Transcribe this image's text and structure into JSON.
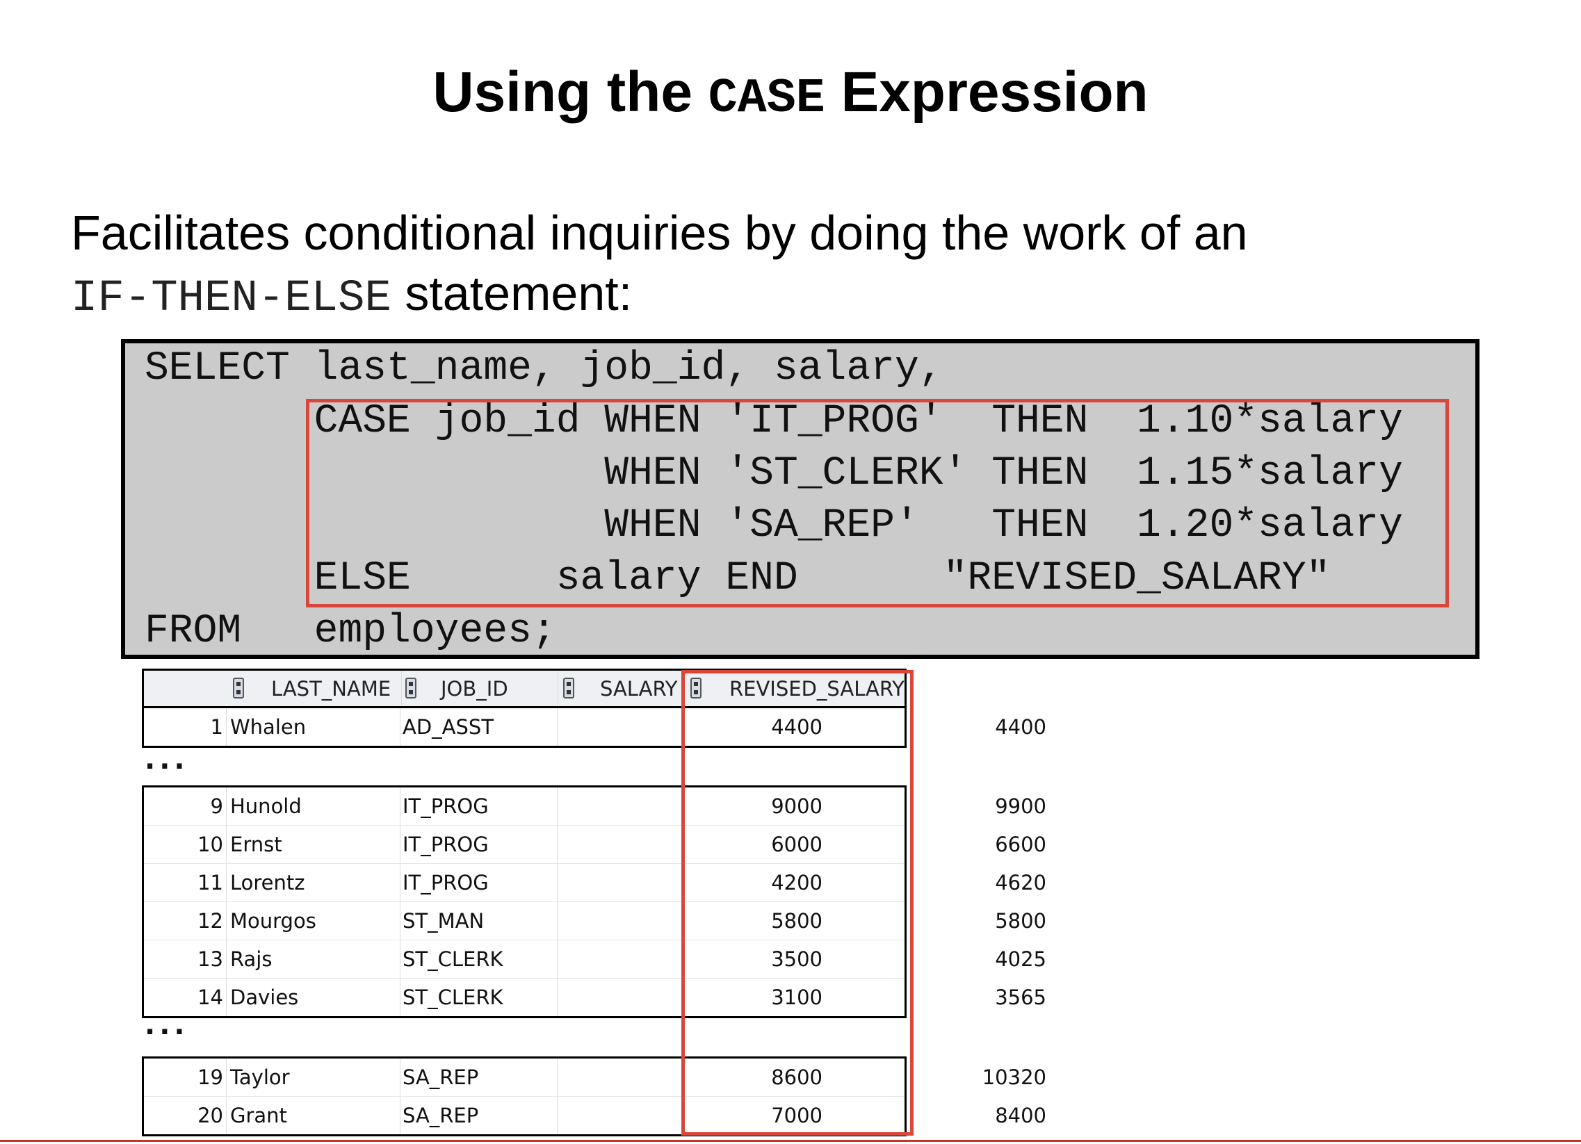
{
  "slide": {
    "title_prefix": "Using the",
    "title_keyword": "CASE",
    "title_suffix": "Expression",
    "description_line1": "Facilitates conditional inquiries by doing the work of an",
    "description_keyword": "IF-THEN-ELSE",
    "description_suffix": "statement:"
  },
  "code": {
    "lines": [
      "SELECT last_name, job_id, salary,",
      "       CASE job_id WHEN 'IT_PROG'  THEN  1.10*salary",
      "                   WHEN 'ST_CLERK' THEN  1.15*salary",
      "                   WHEN 'SA_REP'   THEN  1.20*salary",
      "       ELSE      salary END      \"REVISED_SALARY\"",
      "FROM   employees;"
    ]
  },
  "results": {
    "columns": [
      "LAST_NAME",
      "JOB_ID",
      "SALARY",
      "REVISED_SALARY"
    ],
    "ellipsis": "...",
    "group1": [
      {
        "num": "1",
        "name": "Whalen",
        "job": "AD_ASST",
        "salary": "4400",
        "revised": "4400"
      }
    ],
    "group2": [
      {
        "num": "9",
        "name": "Hunold",
        "job": "IT_PROG",
        "salary": "9000",
        "revised": "9900"
      },
      {
        "num": "10",
        "name": "Ernst",
        "job": "IT_PROG",
        "salary": "6000",
        "revised": "6600"
      },
      {
        "num": "11",
        "name": "Lorentz",
        "job": "IT_PROG",
        "salary": "4200",
        "revised": "4620"
      },
      {
        "num": "12",
        "name": "Mourgos",
        "job": "ST_MAN",
        "salary": "5800",
        "revised": "5800"
      },
      {
        "num": "13",
        "name": "Rajs",
        "job": "ST_CLERK",
        "salary": "3500",
        "revised": "4025"
      },
      {
        "num": "14",
        "name": "Davies",
        "job": "ST_CLERK",
        "salary": "3100",
        "revised": "3565"
      }
    ],
    "group3": [
      {
        "num": "19",
        "name": "Taylor",
        "job": "SA_REP",
        "salary": "8600",
        "revised": "10320"
      },
      {
        "num": "20",
        "name": "Grant",
        "job": "SA_REP",
        "salary": "7000",
        "revised": "8400"
      }
    ]
  },
  "colors": {
    "highlight": "#d9473a",
    "code_background": "#cbcbcb"
  }
}
